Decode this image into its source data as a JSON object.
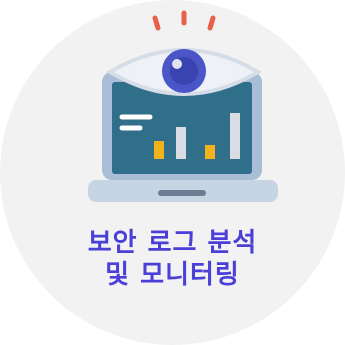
{
  "caption": {
    "line1": "보안 로그 분석",
    "line2": "및 모니터링"
  },
  "icon": {
    "name": "security-log-monitoring-icon",
    "colors": {
      "background_disc": "#f2f2f2",
      "laptop_body": "#a9bdd6",
      "laptop_base": "#c7d4e4",
      "screen": "#2f6f8a",
      "eye_white": "#eef1f5",
      "eye_outline": "#d5dde8",
      "iris": "#4a55c8",
      "bar_yellow": "#f2b21b",
      "bar_gray": "#d9dde3",
      "spark": "#e8604a",
      "caption": "#4a3fd6"
    }
  }
}
